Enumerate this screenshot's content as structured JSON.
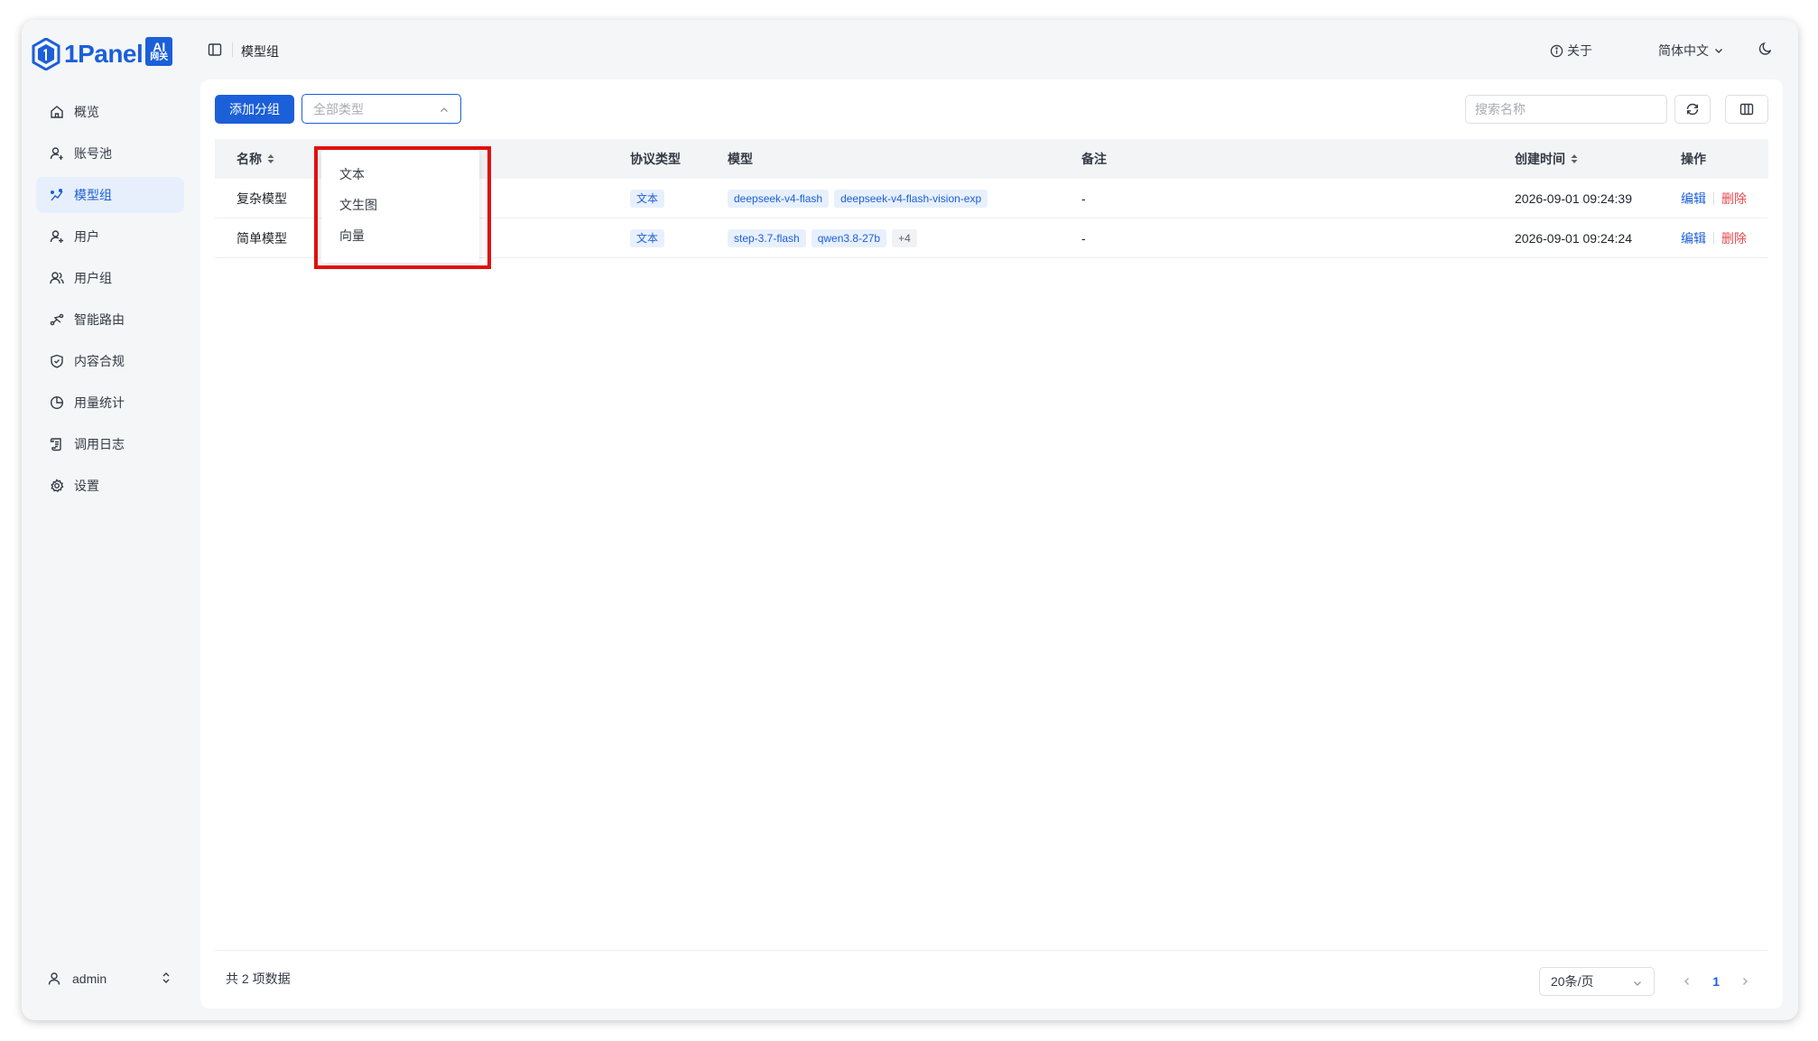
{
  "app": {
    "logo_text": "1Panel",
    "badge_top": "AI",
    "badge_bottom": "网关"
  },
  "sidebar": {
    "items": [
      {
        "label": "概览",
        "icon": "home-icon"
      },
      {
        "label": "账号池",
        "icon": "account-pool-icon"
      },
      {
        "label": "模型组",
        "icon": "model-group-icon",
        "active": true
      },
      {
        "label": "用户",
        "icon": "user-add-icon"
      },
      {
        "label": "用户组",
        "icon": "users-icon"
      },
      {
        "label": "智能路由",
        "icon": "route-icon"
      },
      {
        "label": "内容合规",
        "icon": "shield-icon"
      },
      {
        "label": "用量统计",
        "icon": "pie-chart-icon"
      },
      {
        "label": "调用日志",
        "icon": "log-icon"
      },
      {
        "label": "设置",
        "icon": "gear-icon"
      }
    ],
    "user": "admin"
  },
  "header": {
    "title": "模型组",
    "about": "关于",
    "language": "简体中文"
  },
  "toolbar": {
    "add_button": "添加分组",
    "type_select_placeholder": "全部类型",
    "search_placeholder": "搜索名称"
  },
  "dropdown": {
    "options": [
      "文本",
      "文生图",
      "向量"
    ]
  },
  "table": {
    "columns": {
      "name": "名称",
      "protocol": "协议类型",
      "model": "模型",
      "note": "备注",
      "created": "创建时间",
      "ops": "操作"
    },
    "rows": [
      {
        "name": "复杂模型",
        "protocol": "文本",
        "models": [
          "deepseek-v4-flash",
          "deepseek-v4-flash-vision-exp"
        ],
        "extra": "",
        "note": "-",
        "created": "2026-09-01 09:24:39",
        "edit": "编辑",
        "delete": "删除"
      },
      {
        "name": "简单模型",
        "protocol": "文本",
        "models": [
          "step-3.7-flash",
          "qwen3.8-27b"
        ],
        "extra": "+4",
        "note": "-",
        "created": "2026-09-01 09:24:24",
        "edit": "编辑",
        "delete": "删除"
      }
    ]
  },
  "footer": {
    "total": "共 2 项数据",
    "page_size": "20条/页",
    "current_page": "1"
  },
  "colors": {
    "primary": "#1b5fd9",
    "danger": "#e5484d",
    "highlight": "#e01010"
  }
}
